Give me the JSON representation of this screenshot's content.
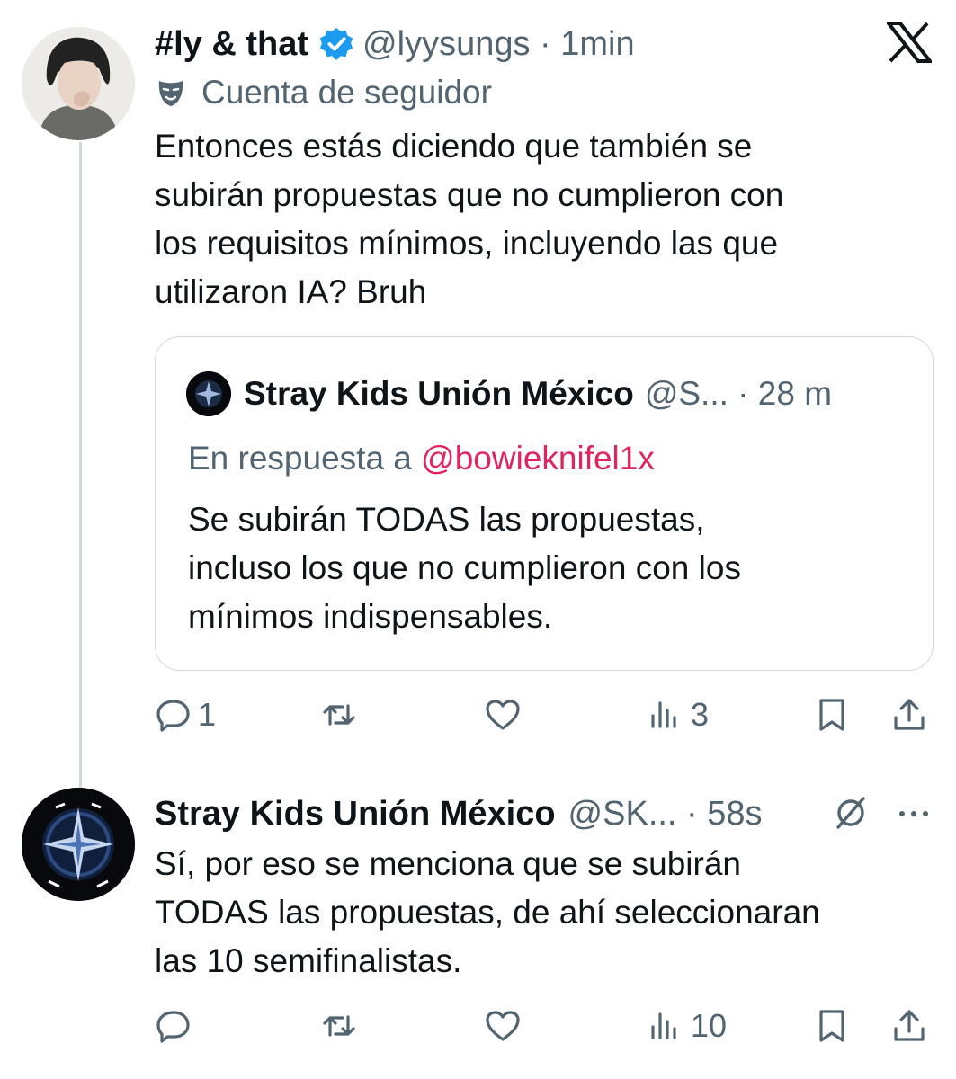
{
  "tweet1": {
    "name": "#ly & that",
    "handle": "@lyysungs",
    "time": "1min",
    "follower_label": "Cuenta de seguidor",
    "text_lines": [
      "Entonces estás diciendo que también se",
      "subirán propuestas que no cumplieron con",
      "los requisitos mínimos, incluyendo las que",
      "utilizaron IA? Bruh"
    ],
    "quote": {
      "name": "Stray Kids Unión México",
      "handle": "@S...",
      "time": "28 m",
      "reply_prefix": "En respuesta a",
      "reply_mention": "@bowieknifel1x",
      "text_lines": [
        "Se subirán TODAS las propuestas,",
        "incluso los que no cumplieron con los",
        "mínimos indispensables."
      ]
    },
    "actions": {
      "replies": "1",
      "reposts": "",
      "likes": "",
      "views": "3"
    }
  },
  "tweet2": {
    "name": "Stray Kids Unión México",
    "handle": "@SK...",
    "time": "58s",
    "text_lines": [
      "Sí, por eso se menciona que se subirán",
      "TODAS las propuestas, de ahí seleccionaran",
      "las 10 semifinalistas."
    ],
    "actions": {
      "replies": "",
      "reposts": "",
      "likes": "",
      "views": "10"
    }
  },
  "colors": {
    "text_primary": "#0f1419",
    "text_secondary": "#536471",
    "verified_blue": "#1d9bf0",
    "mention_pink": "#e0245e",
    "border": "#cfd9de"
  },
  "icons": [
    "x-logo-icon",
    "verified-badge-icon",
    "mask-icon",
    "reply-icon",
    "repost-icon",
    "like-icon",
    "views-icon",
    "bookmark-icon",
    "share-icon",
    "grok-icon",
    "more-icon"
  ]
}
